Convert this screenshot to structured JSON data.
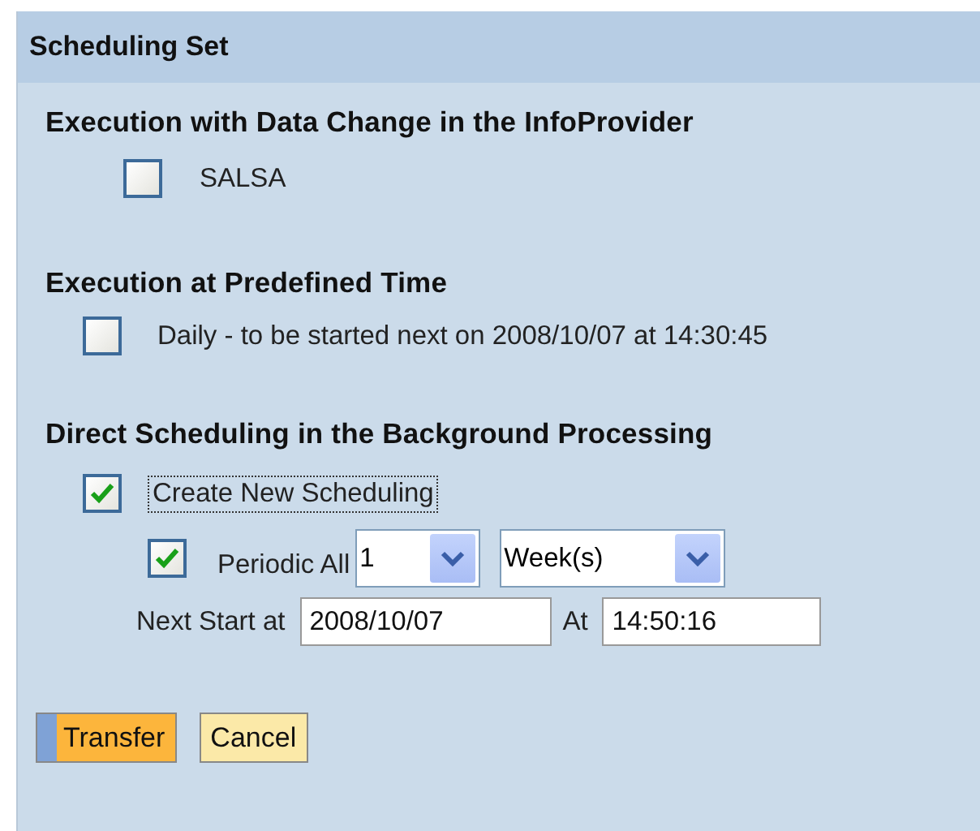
{
  "panel": {
    "title": "Scheduling Set"
  },
  "data_change": {
    "heading": "Execution with Data Change in the InfoProvider",
    "option": {
      "label": "SALSA",
      "checked": false
    }
  },
  "predefined_time": {
    "heading": "Execution at Predefined Time",
    "option": {
      "label": "Daily - to be started next on 2008/10/07 at 14:30:45",
      "checked": false
    }
  },
  "direct_scheduling": {
    "heading": "Direct Scheduling in the Background Processing",
    "create_new": {
      "label": "Create New Scheduling",
      "checked": true,
      "focused": true
    },
    "periodic": {
      "label": "Periodic All",
      "checked": true,
      "count": "1",
      "unit": "Week(s)"
    },
    "next_start": {
      "label": "Next Start at",
      "date": "2008/10/07",
      "time_label": "At",
      "time": "14:50:16"
    }
  },
  "buttons": [
    {
      "label": "Transfer",
      "kind": "primary"
    },
    {
      "label": "Cancel",
      "kind": "secondary"
    }
  ]
}
